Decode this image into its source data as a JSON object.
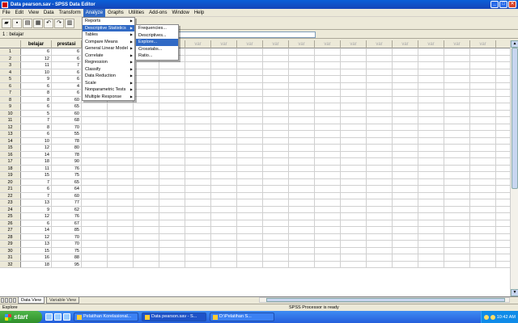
{
  "window": {
    "title": "Data pearson.sav - SPSS Data Editor",
    "buttons": [
      "_",
      "□",
      "✕"
    ]
  },
  "menubar": [
    "File",
    "Edit",
    "View",
    "Data",
    "Transform",
    "Analyze",
    "Graphs",
    "Utilities",
    "Add-ons",
    "Window",
    "Help"
  ],
  "active_menu_index": 5,
  "cellbar": {
    "ref": "1 : belajar",
    "value": "6"
  },
  "columns": {
    "col1": "belajar",
    "col2": "prestasi",
    "var_placeholder": "var"
  },
  "rows": [
    {
      "n": "1",
      "belajar": "6",
      "prestasi": "6"
    },
    {
      "n": "2",
      "belajar": "12",
      "prestasi": "6"
    },
    {
      "n": "3",
      "belajar": "11",
      "prestasi": "7"
    },
    {
      "n": "4",
      "belajar": "10",
      "prestasi": "6"
    },
    {
      "n": "5",
      "belajar": "9",
      "prestasi": "6"
    },
    {
      "n": "6",
      "belajar": "6",
      "prestasi": "4"
    },
    {
      "n": "7",
      "belajar": "8",
      "prestasi": "6"
    },
    {
      "n": "8",
      "belajar": "8",
      "prestasi": "60"
    },
    {
      "n": "9",
      "belajar": "6",
      "prestasi": "65"
    },
    {
      "n": "10",
      "belajar": "5",
      "prestasi": "60"
    },
    {
      "n": "11",
      "belajar": "7",
      "prestasi": "68"
    },
    {
      "n": "12",
      "belajar": "8",
      "prestasi": "70"
    },
    {
      "n": "13",
      "belajar": "6",
      "prestasi": "55"
    },
    {
      "n": "14",
      "belajar": "10",
      "prestasi": "78"
    },
    {
      "n": "15",
      "belajar": "12",
      "prestasi": "80"
    },
    {
      "n": "16",
      "belajar": "14",
      "prestasi": "78"
    },
    {
      "n": "17",
      "belajar": "18",
      "prestasi": "90"
    },
    {
      "n": "18",
      "belajar": "11",
      "prestasi": "76"
    },
    {
      "n": "19",
      "belajar": "15",
      "prestasi": "75"
    },
    {
      "n": "20",
      "belajar": "7",
      "prestasi": "65"
    },
    {
      "n": "21",
      "belajar": "6",
      "prestasi": "64"
    },
    {
      "n": "22",
      "belajar": "7",
      "prestasi": "60"
    },
    {
      "n": "23",
      "belajar": "13",
      "prestasi": "77"
    },
    {
      "n": "24",
      "belajar": "9",
      "prestasi": "62"
    },
    {
      "n": "25",
      "belajar": "12",
      "prestasi": "76"
    },
    {
      "n": "26",
      "belajar": "6",
      "prestasi": "67"
    },
    {
      "n": "27",
      "belajar": "14",
      "prestasi": "85"
    },
    {
      "n": "28",
      "belajar": "12",
      "prestasi": "70"
    },
    {
      "n": "29",
      "belajar": "13",
      "prestasi": "70"
    },
    {
      "n": "30",
      "belajar": "15",
      "prestasi": "75"
    },
    {
      "n": "31",
      "belajar": "16",
      "prestasi": "88"
    },
    {
      "n": "32",
      "belajar": "18",
      "prestasi": "95"
    }
  ],
  "analyze_menu": [
    {
      "label": "Reports",
      "sub": true
    },
    {
      "label": "Descriptive Statistics",
      "sub": true,
      "highlight": true
    },
    {
      "label": "Tables",
      "sub": true
    },
    {
      "label": "Compare Means",
      "sub": true
    },
    {
      "label": "General Linear Model",
      "sub": true
    },
    {
      "label": "Correlate",
      "sub": true
    },
    {
      "label": "Regression",
      "sub": true
    },
    {
      "label": "Classify",
      "sub": true
    },
    {
      "label": "Data Reduction",
      "sub": true
    },
    {
      "label": "Scale",
      "sub": true
    },
    {
      "label": "Nonparametric Tests",
      "sub": true
    },
    {
      "label": "Multiple Response",
      "sub": true
    }
  ],
  "desc_submenu": [
    {
      "label": "Frequencies..."
    },
    {
      "label": "Descriptives..."
    },
    {
      "label": "Explore...",
      "highlight": true
    },
    {
      "label": "Crosstabs..."
    },
    {
      "label": "Ratio..."
    }
  ],
  "tabs": {
    "data_view": "Data View",
    "variable_view": "Variable View"
  },
  "status": {
    "left": "Explore",
    "mid": "SPSS Processor  is ready"
  },
  "taskbar": {
    "start": "start",
    "tasks": [
      "Pelatihan Korelasional...",
      "Data pearson.sav - S...",
      "D:\\Pelatihan S..."
    ],
    "clock": "10:42 AM"
  },
  "colors": {
    "titlebar": "#0a5fd8",
    "highlight": "#316ac5",
    "taskbar": "#245edb",
    "start": "#2f8f2a"
  }
}
